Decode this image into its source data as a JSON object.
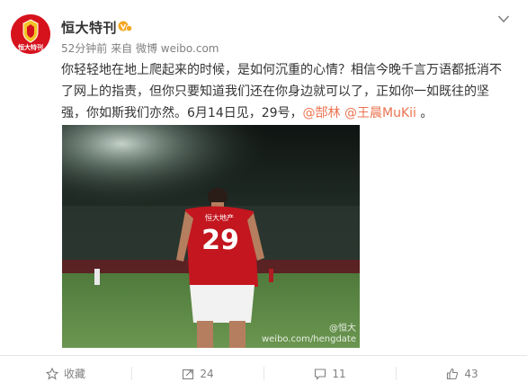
{
  "post": {
    "username": "恒大特刊",
    "time": "52分钟前",
    "source_prefix": "来自",
    "source": "微博 weibo.com",
    "text_line1": "你轻轻地在地上爬起来的时候，是如何沉重的心情？相信今晚千言万语都抵消不",
    "text_line2": "了网上的指责，但你只要知道我们还在你身边就可以了，正如你一如既往的坚",
    "text_line3_plain": "强，你如斯我们亦然。6月14日见，29号，",
    "mention1": "@郜林",
    "mention2": "@王晨MuKii",
    "text_end": "。",
    "avatar_text": "恒大特刊",
    "jersey_sponsor": "恒大地产",
    "jersey_number": "29",
    "watermark_line1": "@恒大",
    "watermark_line2": "weibo.com/hengdate"
  },
  "actions": {
    "favorite_label": "收藏",
    "repost_count": "24",
    "comment_count": "11",
    "like_count": "43"
  },
  "colors": {
    "mention": "#eb7350",
    "avatar_red": "#d6121d",
    "meta_gray": "#808080"
  }
}
